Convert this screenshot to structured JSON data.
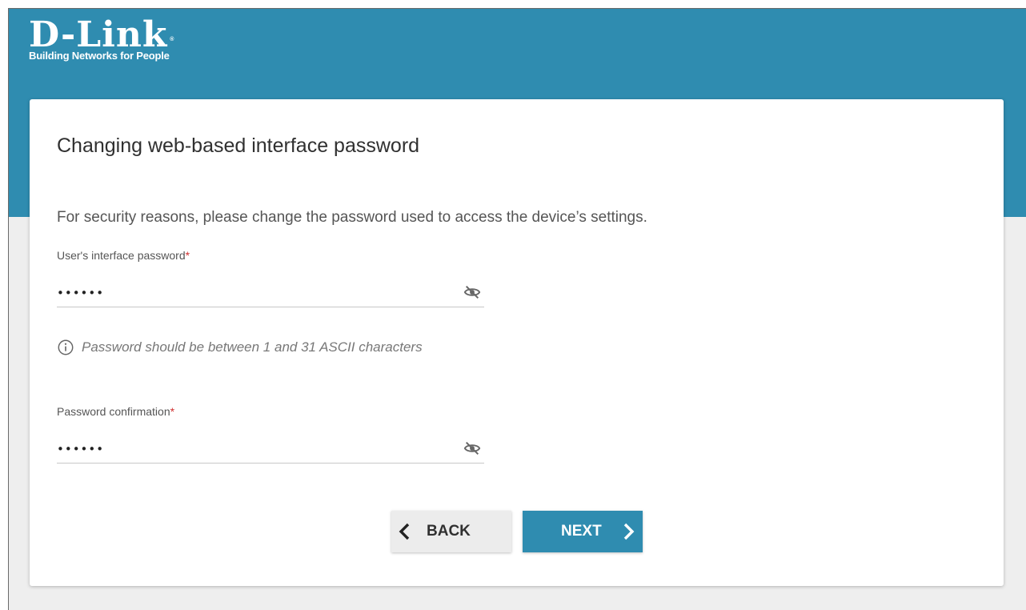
{
  "brand": {
    "name": "D-Link",
    "registered_mark": "®",
    "tagline": "Building Networks for People"
  },
  "page": {
    "title": "Changing web-based interface password",
    "description": "For security reasons, please change the password used to access the device’s settings."
  },
  "form": {
    "password": {
      "label": "User's interface password",
      "required_mark": "*",
      "value": "••••••",
      "visibility_icon": "eye-off-icon"
    },
    "hint": {
      "icon": "info-icon",
      "text": "Password should be between 1 and 31 ASCII characters"
    },
    "confirmation": {
      "label": "Password confirmation",
      "required_mark": "*",
      "value": "••••••",
      "visibility_icon": "eye-off-icon"
    }
  },
  "buttons": {
    "back_label": "BACK",
    "next_label": "NEXT"
  },
  "colors": {
    "brand_blue": "#2f8cb0",
    "required_red": "#d03030",
    "card_background": "#ffffff",
    "page_background": "#eeeeee"
  }
}
